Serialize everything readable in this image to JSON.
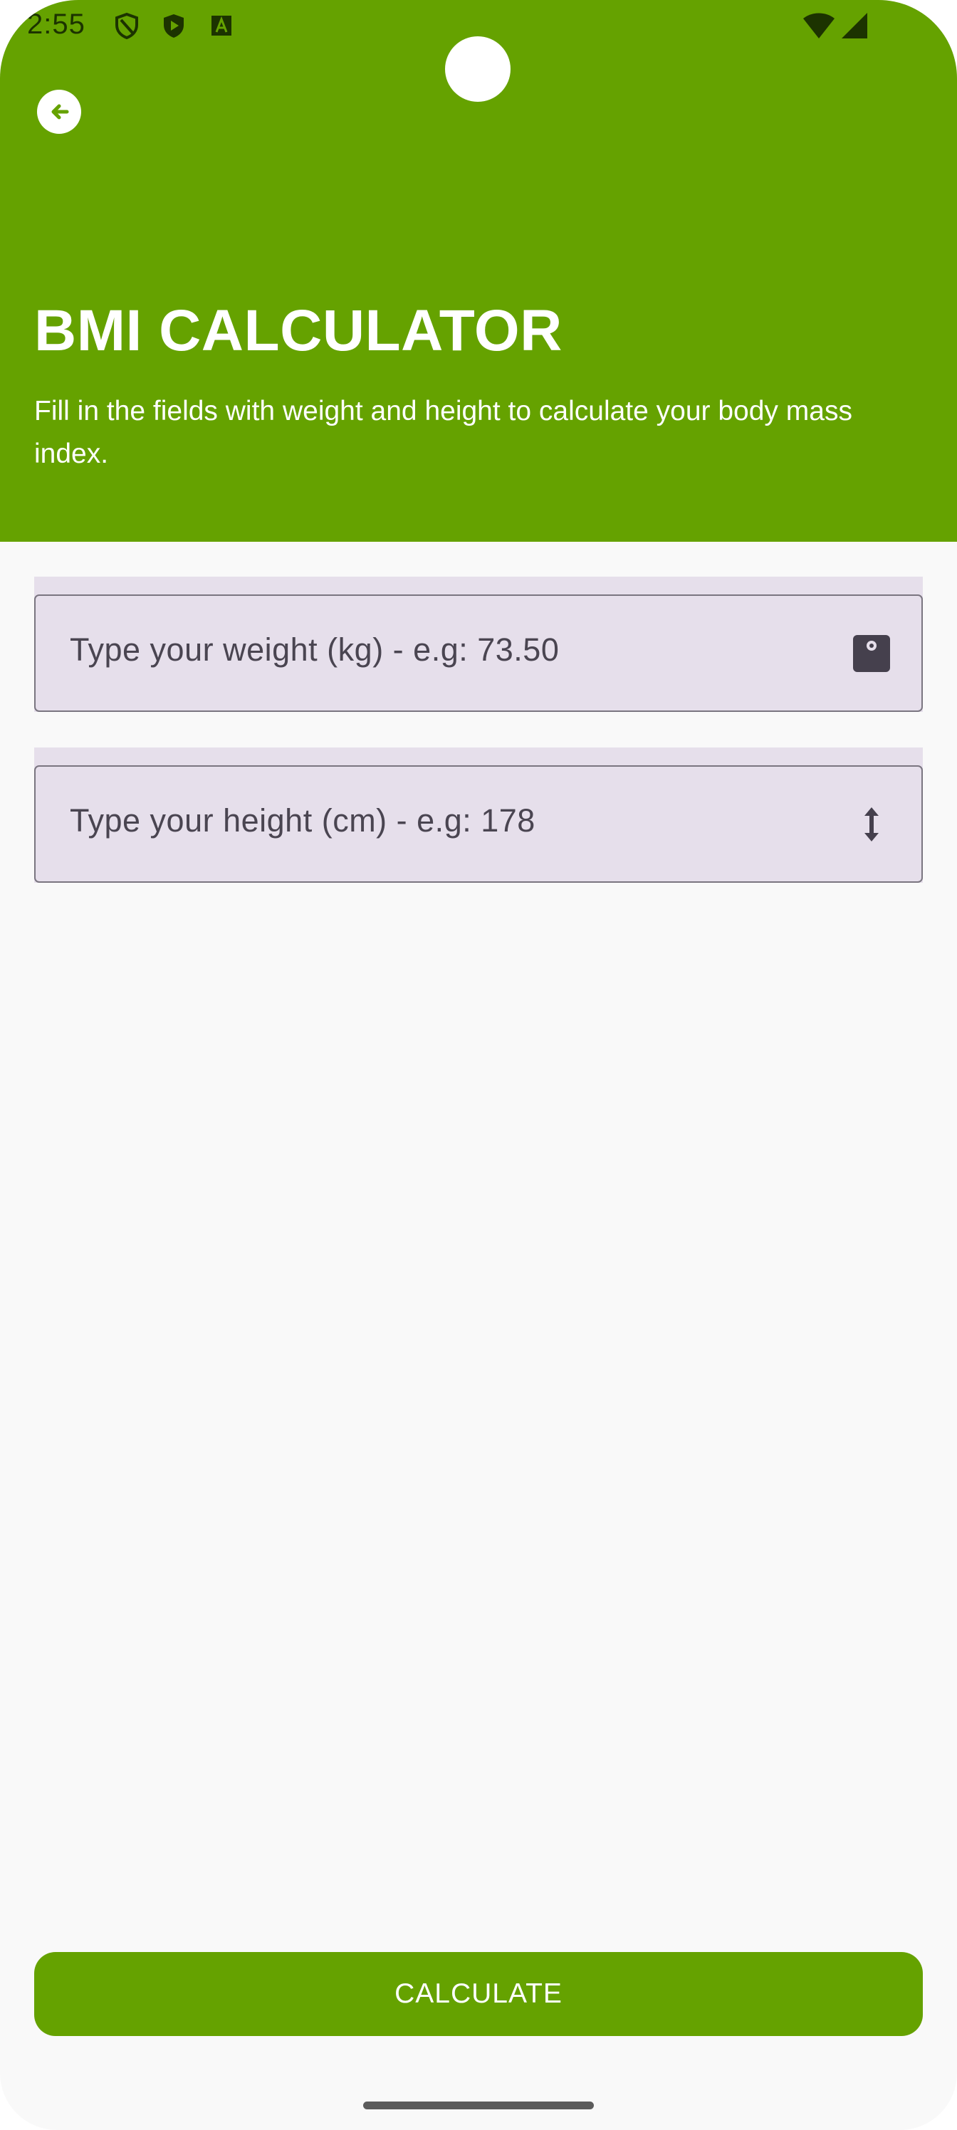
{
  "status_bar": {
    "time": "2:55",
    "icons": [
      "shield-outline-icon",
      "shield-play-icon",
      "font-a-icon",
      "wifi-icon",
      "cell-signal-icon"
    ]
  },
  "header": {
    "title": "BMI CALCULATOR",
    "subtitle": "Fill in the fields with weight and height to calculate your body mass index.",
    "background_color": "#65a200"
  },
  "form": {
    "weight_field": {
      "placeholder": "Type your weight (kg) - e.g: 73.50",
      "value": "",
      "icon": "scale-icon"
    },
    "height_field": {
      "placeholder": "Type your height (cm) - e.g: 178",
      "value": "",
      "icon": "vertical-arrows-icon"
    }
  },
  "actions": {
    "calculate_label": "CALCULATE",
    "button_color": "#65a200"
  }
}
